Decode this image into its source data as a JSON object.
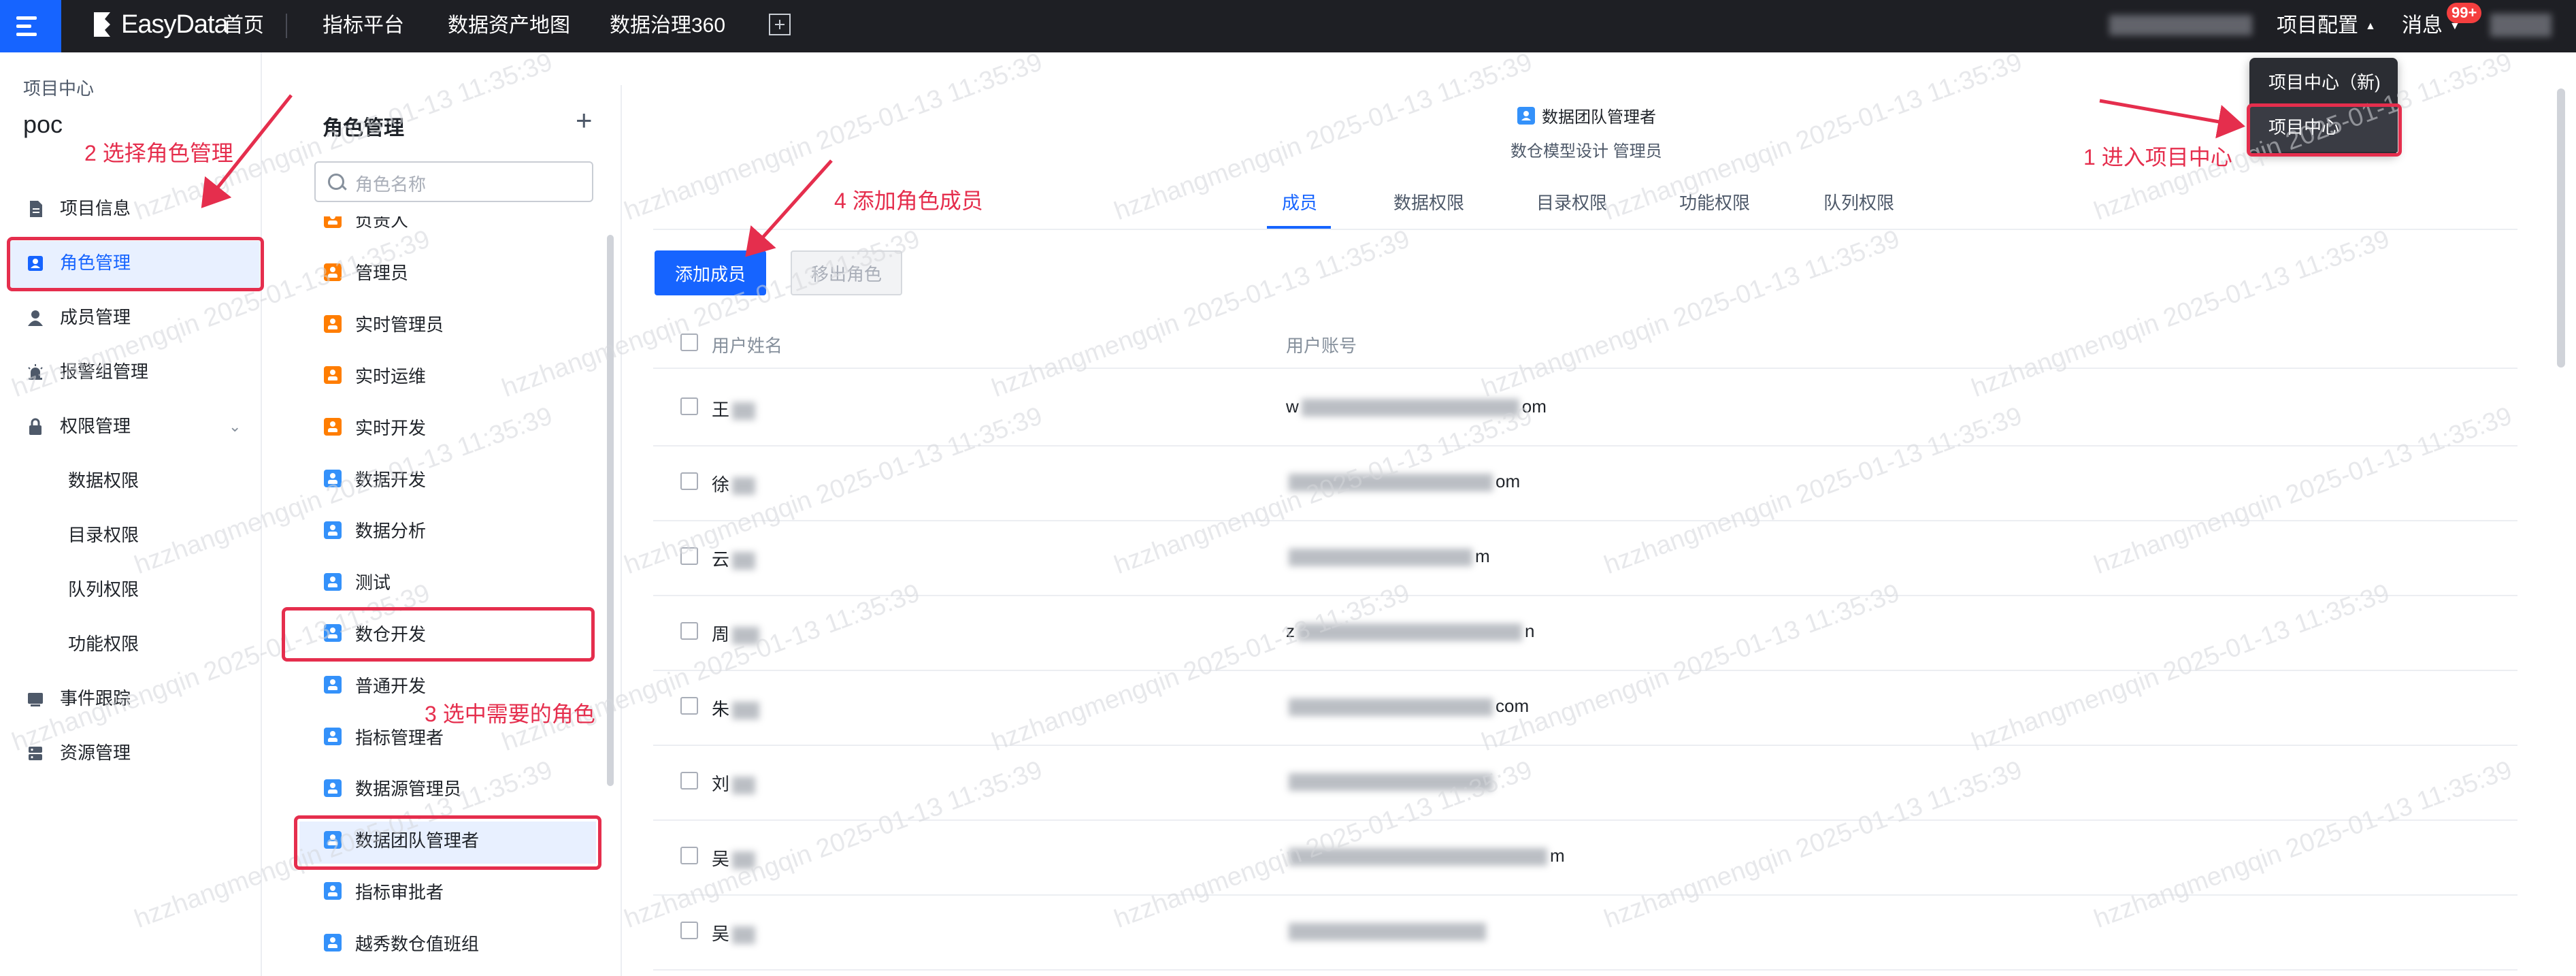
{
  "topbar": {
    "brand": "EasyData",
    "nav": [
      "首页",
      "指标平台",
      "数据资产地图",
      "数据治理360"
    ],
    "project_config": "项目配置",
    "messages": "消息",
    "badge": "99+"
  },
  "dropdown": {
    "items": [
      "项目中心（新)",
      "项目中心"
    ]
  },
  "sidebar": {
    "caption": "项目中心",
    "project": "poc",
    "items": [
      {
        "label": "项目信息",
        "icon": "document-icon"
      },
      {
        "label": "角色管理",
        "icon": "role-badge-icon"
      },
      {
        "label": "成员管理",
        "icon": "user-icon"
      },
      {
        "label": "报警组管理",
        "icon": "alarm-icon"
      },
      {
        "label": "权限管理",
        "icon": "lock-icon"
      }
    ],
    "sub_items": [
      "数据权限",
      "目录权限",
      "队列权限",
      "功能权限"
    ],
    "items_bottom": [
      {
        "label": "事件跟踪",
        "icon": "event-icon"
      },
      {
        "label": "资源管理",
        "icon": "server-icon"
      }
    ]
  },
  "roles": {
    "title": "角色管理",
    "search_placeholder": "角色名称",
    "items": [
      {
        "label": "负责人",
        "color": "orange"
      },
      {
        "label": "管理员",
        "color": "orange"
      },
      {
        "label": "实时管理员",
        "color": "orange"
      },
      {
        "label": "实时运维",
        "color": "orange"
      },
      {
        "label": "实时开发",
        "color": "orange"
      },
      {
        "label": "数据开发",
        "color": "blue"
      },
      {
        "label": "数据分析",
        "color": "blue"
      },
      {
        "label": "测试",
        "color": "blue"
      },
      {
        "label": "数仓开发",
        "color": "blue"
      },
      {
        "label": "普通开发",
        "color": "blue"
      },
      {
        "label": "指标管理者",
        "color": "blue"
      },
      {
        "label": "数据源管理员",
        "color": "blue"
      },
      {
        "label": "数据团队管理者",
        "color": "blue"
      },
      {
        "label": "指标审批者",
        "color": "blue"
      },
      {
        "label": "越秀数仓值班组",
        "color": "blue"
      }
    ]
  },
  "main": {
    "team_name": "数据团队管理者",
    "team_sub": "数仓模型设计 管理员",
    "tabs": [
      "成员",
      "数据权限",
      "目录权限",
      "功能权限",
      "队列权限"
    ],
    "add_member": "添加成员",
    "remove_role": "移出角色",
    "columns": [
      "用户姓名",
      "用户账号"
    ],
    "rows": [
      {
        "name": "王",
        "account": "w",
        "account_tail": "om"
      },
      {
        "name": "徐",
        "account": "",
        "account_tail": "om"
      },
      {
        "name": "云",
        "account": "",
        "account_tail": "m"
      },
      {
        "name": "周",
        "account": "z",
        "account_tail": "n"
      },
      {
        "name": "朱",
        "account": "",
        "account_tail": "com"
      },
      {
        "name": "刘",
        "account": "",
        "account_tail": ""
      },
      {
        "name": "吴",
        "account": "",
        "account_tail": "m"
      },
      {
        "name": "吴",
        "account": "",
        "account_tail": ""
      }
    ]
  },
  "annotations": {
    "step1": "1 进入项目中心",
    "step2": "2 选择角色管理",
    "step3": "3 选中需要的角色",
    "step4": "4 添加角色成员"
  },
  "watermark": "hzzhangmengqin 2025-01-13 11:35:39",
  "colors": {
    "accent": "#1664ff",
    "annotation": "#e52e4d",
    "topbar": "#1e1f24"
  }
}
